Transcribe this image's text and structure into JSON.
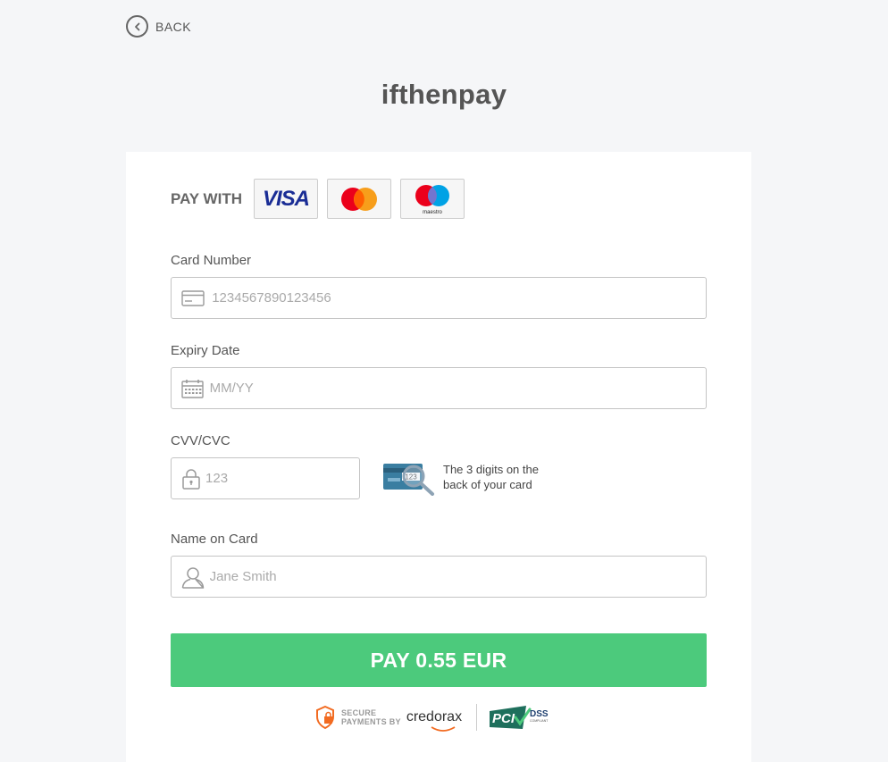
{
  "nav": {
    "back_label": "BACK"
  },
  "brand": {
    "name": "ifthenpay"
  },
  "pay_with": {
    "label": "PAY WITH",
    "methods": [
      {
        "name": "VISA",
        "icon": "visa-logo"
      },
      {
        "name": "Mastercard",
        "icon": "mastercard-logo"
      },
      {
        "name": "maestro",
        "icon": "maestro-logo"
      }
    ]
  },
  "form": {
    "card_number": {
      "label": "Card Number",
      "placeholder": "1234567890123456",
      "value": ""
    },
    "expiry": {
      "label": "Expiry Date",
      "placeholder": "MM/YY",
      "value": ""
    },
    "cvv": {
      "label": "CVV/CVC",
      "placeholder": "123",
      "value": "",
      "hint": "The 3 digits on the back of your card",
      "hint_card_digits": "123"
    },
    "name": {
      "label": "Name on Card",
      "placeholder": "Jane Smith",
      "value": ""
    }
  },
  "pay_button": {
    "label": "PAY 0.55 EUR"
  },
  "footer": {
    "secure_line1": "SECURE",
    "secure_line2": "PAYMENTS BY",
    "provider": "credorax",
    "pci_main": "PCI",
    "pci_dss": "DSS",
    "pci_sub": "COMPLIANT"
  },
  "colors": {
    "pay_button": "#4cca7c",
    "visa_blue": "#1a2d95",
    "mastercard_red": "#eb001b",
    "mastercard_orange": "#f79e1b",
    "maestro_blue": "#00a2e5",
    "credorax_orange": "#f26b21"
  }
}
